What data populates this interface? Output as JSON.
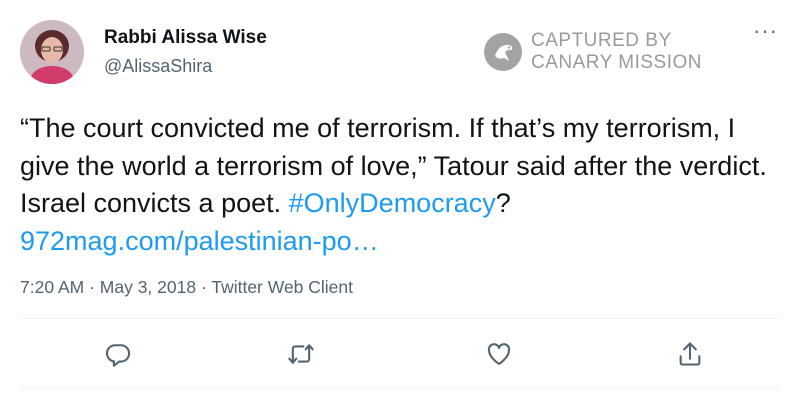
{
  "author": {
    "name": "Rabbi Alissa Wise",
    "handle": "@AlissaShira"
  },
  "watermark": {
    "line1": "CAPTURED BY",
    "line2": "CANARY MISSION"
  },
  "more_label": "···",
  "tweet": {
    "text": "“The court convicted me of terrorism. If that’s my terrorism, I give the world a terrorism of love,” Tatour said after the verdict.  Israel convicts a poet. ",
    "hashtag": "#OnlyDemocracy",
    "after_hashtag": "? ",
    "url": "972mag.com/palestinian-po…"
  },
  "meta": {
    "time": "7:20 AM",
    "separator1": " · ",
    "date": "May 3, 2018",
    "separator2": " · ",
    "client": "Twitter Web Client"
  },
  "actions": [
    {
      "name": "reply",
      "icon": "reply-icon"
    },
    {
      "name": "retweet",
      "icon": "retweet-icon"
    },
    {
      "name": "like",
      "icon": "heart-icon"
    },
    {
      "name": "share",
      "icon": "share-icon"
    }
  ],
  "colors": {
    "link": "#1d9bf0",
    "secondary_text": "#536471",
    "watermark": "#9a9a9a"
  }
}
